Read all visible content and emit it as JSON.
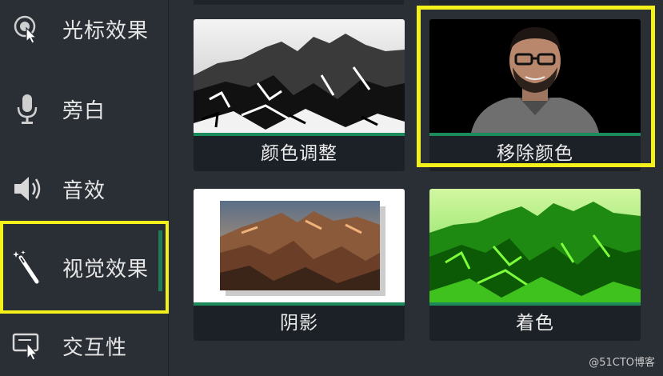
{
  "sidebar": {
    "items": [
      {
        "label": "光标效果",
        "icon": "cursor-effect-icon"
      },
      {
        "label": "旁白",
        "icon": "microphone-icon"
      },
      {
        "label": "音效",
        "icon": "speaker-icon"
      },
      {
        "label": "视觉效果",
        "icon": "magic-wand-icon",
        "selected": true
      },
      {
        "label": "交互性",
        "icon": "interactive-cursor-icon"
      }
    ]
  },
  "effects": {
    "tiles": [
      {
        "label": "颜色调整"
      },
      {
        "label": "移除颜色",
        "selected": true
      },
      {
        "label": "阴影"
      },
      {
        "label": "着色"
      }
    ]
  },
  "watermark": "@51CTO博客",
  "colors": {
    "background": "#2a2e35",
    "tile": "#1c2027",
    "accent_bar": "#1d8a5c",
    "highlight": "#f4f11a"
  }
}
